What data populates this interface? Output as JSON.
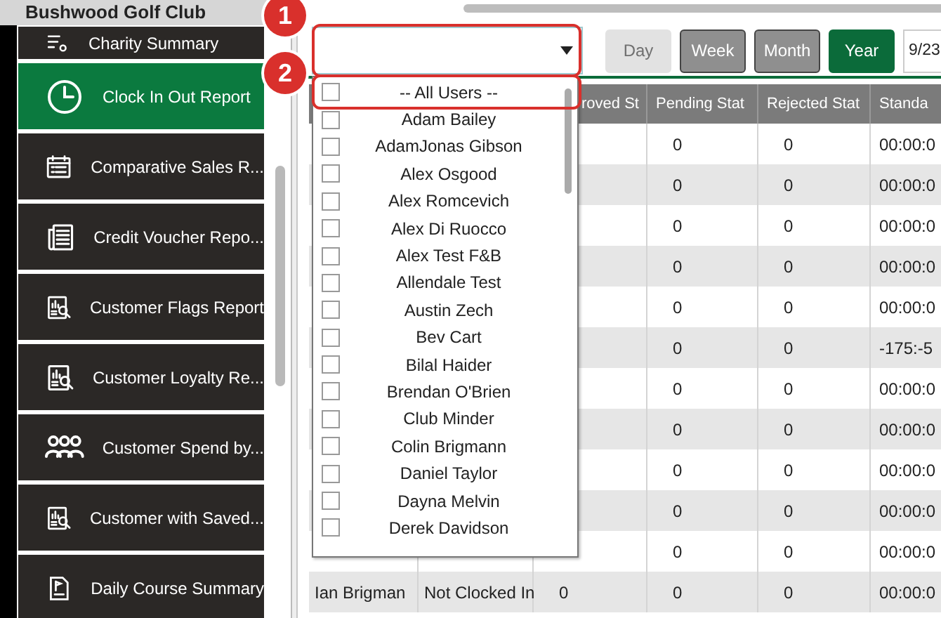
{
  "header": {
    "title": "Bushwood Golf Club"
  },
  "sidebar": {
    "items": [
      {
        "label": "Charity Summary",
        "kind": "list",
        "selected": false
      },
      {
        "label": "Clock In Out Report",
        "kind": "clock",
        "selected": true
      },
      {
        "label": "Comparative Sales R...",
        "kind": "calendar",
        "selected": false
      },
      {
        "label": "Credit Voucher Repo...",
        "kind": "document",
        "selected": false
      },
      {
        "label": "Customer Flags Report",
        "kind": "report",
        "selected": false
      },
      {
        "label": "Customer Loyalty Re...",
        "kind": "report",
        "selected": false
      },
      {
        "label": "Customer Spend by...",
        "kind": "people",
        "selected": false
      },
      {
        "label": "Customer with Saved...",
        "kind": "report",
        "selected": false
      },
      {
        "label": "Daily Course Summary",
        "kind": "flag",
        "selected": false
      }
    ]
  },
  "toolbar": {
    "user_select": {
      "open": true
    },
    "period_buttons": [
      {
        "label": "Day",
        "selected": false,
        "disabled": true
      },
      {
        "label": "Week",
        "selected": false,
        "disabled": false
      },
      {
        "label": "Month",
        "selected": false,
        "disabled": false
      },
      {
        "label": "Year",
        "selected": true,
        "disabled": false
      }
    ],
    "date_field": {
      "value": "9/23"
    }
  },
  "table": {
    "columns": [
      "",
      "",
      "roved St",
      "Pending Stat",
      "Rejected Stat",
      "Standa"
    ],
    "rows": [
      [
        null,
        null,
        null,
        "0",
        "0",
        "00:00:0"
      ],
      [
        null,
        null,
        null,
        "0",
        "0",
        "00:00:0"
      ],
      [
        null,
        null,
        null,
        "0",
        "0",
        "00:00:0"
      ],
      [
        null,
        null,
        null,
        "0",
        "0",
        "00:00:0"
      ],
      [
        null,
        null,
        null,
        "0",
        "0",
        "00:00:0"
      ],
      [
        null,
        null,
        null,
        "0",
        "0",
        "-175:-5"
      ],
      [
        null,
        null,
        null,
        "0",
        "0",
        "00:00:0"
      ],
      [
        null,
        null,
        null,
        "0",
        "0",
        "00:00:0"
      ],
      [
        null,
        null,
        null,
        "0",
        "0",
        "00:00:0"
      ],
      [
        null,
        null,
        null,
        "0",
        "0",
        "00:00:0"
      ],
      [
        null,
        null,
        null,
        "0",
        "0",
        "00:00:0"
      ],
      [
        "Ian Brigman",
        "Not Clocked In",
        "0",
        "0",
        "0",
        "00:00:0"
      ]
    ]
  },
  "user_dropdown": {
    "options": [
      {
        "name": "-- All Users --",
        "checked": false
      },
      {
        "name": "Adam Bailey",
        "checked": false
      },
      {
        "name": "AdamJonas Gibson",
        "checked": false
      },
      {
        "name": "Alex Osgood",
        "checked": false
      },
      {
        "name": "Alex Romcevich",
        "checked": false
      },
      {
        "name": "Alex Di Ruocco",
        "checked": false
      },
      {
        "name": "Alex  Test F&B",
        "checked": false
      },
      {
        "name": "Allendale Test",
        "checked": false
      },
      {
        "name": "Austin Zech",
        "checked": false
      },
      {
        "name": "Bev Cart",
        "checked": false
      },
      {
        "name": "Bilal Haider",
        "checked": false
      },
      {
        "name": "Brendan  O'Brien",
        "checked": false
      },
      {
        "name": "Club Minder",
        "checked": false
      },
      {
        "name": "Colin Brigmann",
        "checked": false
      },
      {
        "name": "Daniel Taylor",
        "checked": false
      },
      {
        "name": "Dayna Melvin",
        "checked": false
      },
      {
        "name": "Derek Davidson",
        "checked": false
      }
    ]
  },
  "annotations": [
    {
      "label": "1"
    },
    {
      "label": "2"
    }
  ]
}
